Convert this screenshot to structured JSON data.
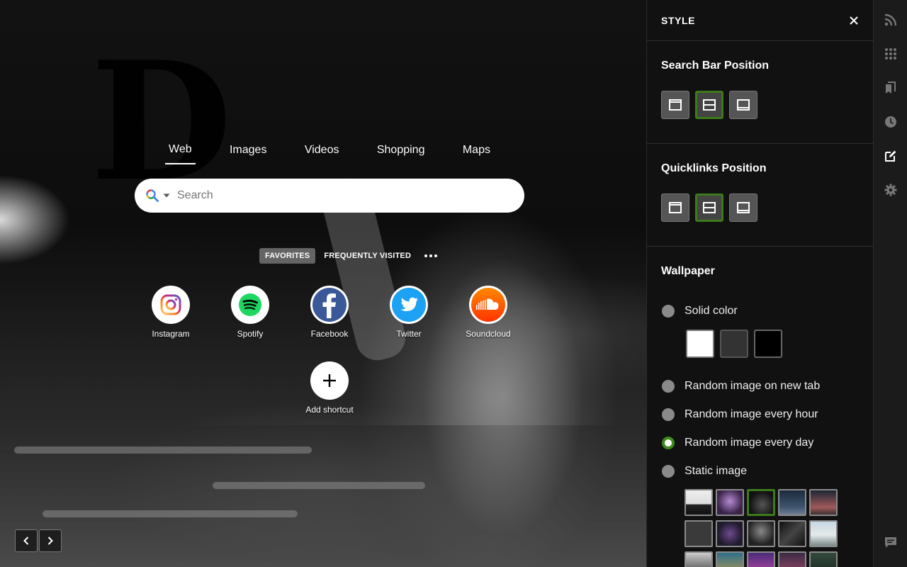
{
  "search": {
    "tabs": [
      {
        "label": "Web",
        "active": true
      },
      {
        "label": "Images",
        "active": false
      },
      {
        "label": "Videos",
        "active": false
      },
      {
        "label": "Shopping",
        "active": false
      },
      {
        "label": "Maps",
        "active": false
      }
    ],
    "placeholder": "Search",
    "engine_icon": "search-engine-icon"
  },
  "quicklinks": {
    "tabs": [
      {
        "label": "FAVORITES",
        "active": true
      },
      {
        "label": "FREQUENTLY VISITED",
        "active": false
      }
    ],
    "more_icon": "more-dots-icon",
    "items": [
      {
        "label": "Instagram",
        "icon": "instagram-icon"
      },
      {
        "label": "Spotify",
        "icon": "spotify-icon"
      },
      {
        "label": "Facebook",
        "icon": "facebook-icon"
      },
      {
        "label": "Twitter",
        "icon": "twitter-icon"
      },
      {
        "label": "Soundcloud",
        "icon": "soundcloud-icon"
      }
    ],
    "add_label": "Add shortcut"
  },
  "panel": {
    "title": "STYLE",
    "search_bar_position": {
      "heading": "Search Bar Position",
      "options": [
        "top",
        "middle",
        "bottom"
      ],
      "selected": "middle"
    },
    "quicklinks_position": {
      "heading": "Quicklinks Position",
      "options": [
        "top",
        "middle",
        "bottom"
      ],
      "selected": "middle"
    },
    "wallpaper": {
      "heading": "Wallpaper",
      "options": [
        {
          "label": "Solid color",
          "selected": false
        },
        {
          "label": "Random image on new tab",
          "selected": false
        },
        {
          "label": "Random image every hour",
          "selected": false
        },
        {
          "label": "Random image every day",
          "selected": true
        },
        {
          "label": "Static image",
          "selected": false
        }
      ],
      "solid_colors": [
        "#ffffff",
        "#333333",
        "#000000"
      ],
      "selected_thumbnail": 2
    }
  },
  "rail": [
    "rss-icon",
    "apps-grid-icon",
    "bookmarks-icon",
    "history-icon",
    "style-edit-icon",
    "settings-gear-icon",
    "feedback-icon"
  ],
  "colors": {
    "accent": "#3d7a1a",
    "panel_bg": "#111111",
    "rail_bg": "#1b1b1b"
  }
}
